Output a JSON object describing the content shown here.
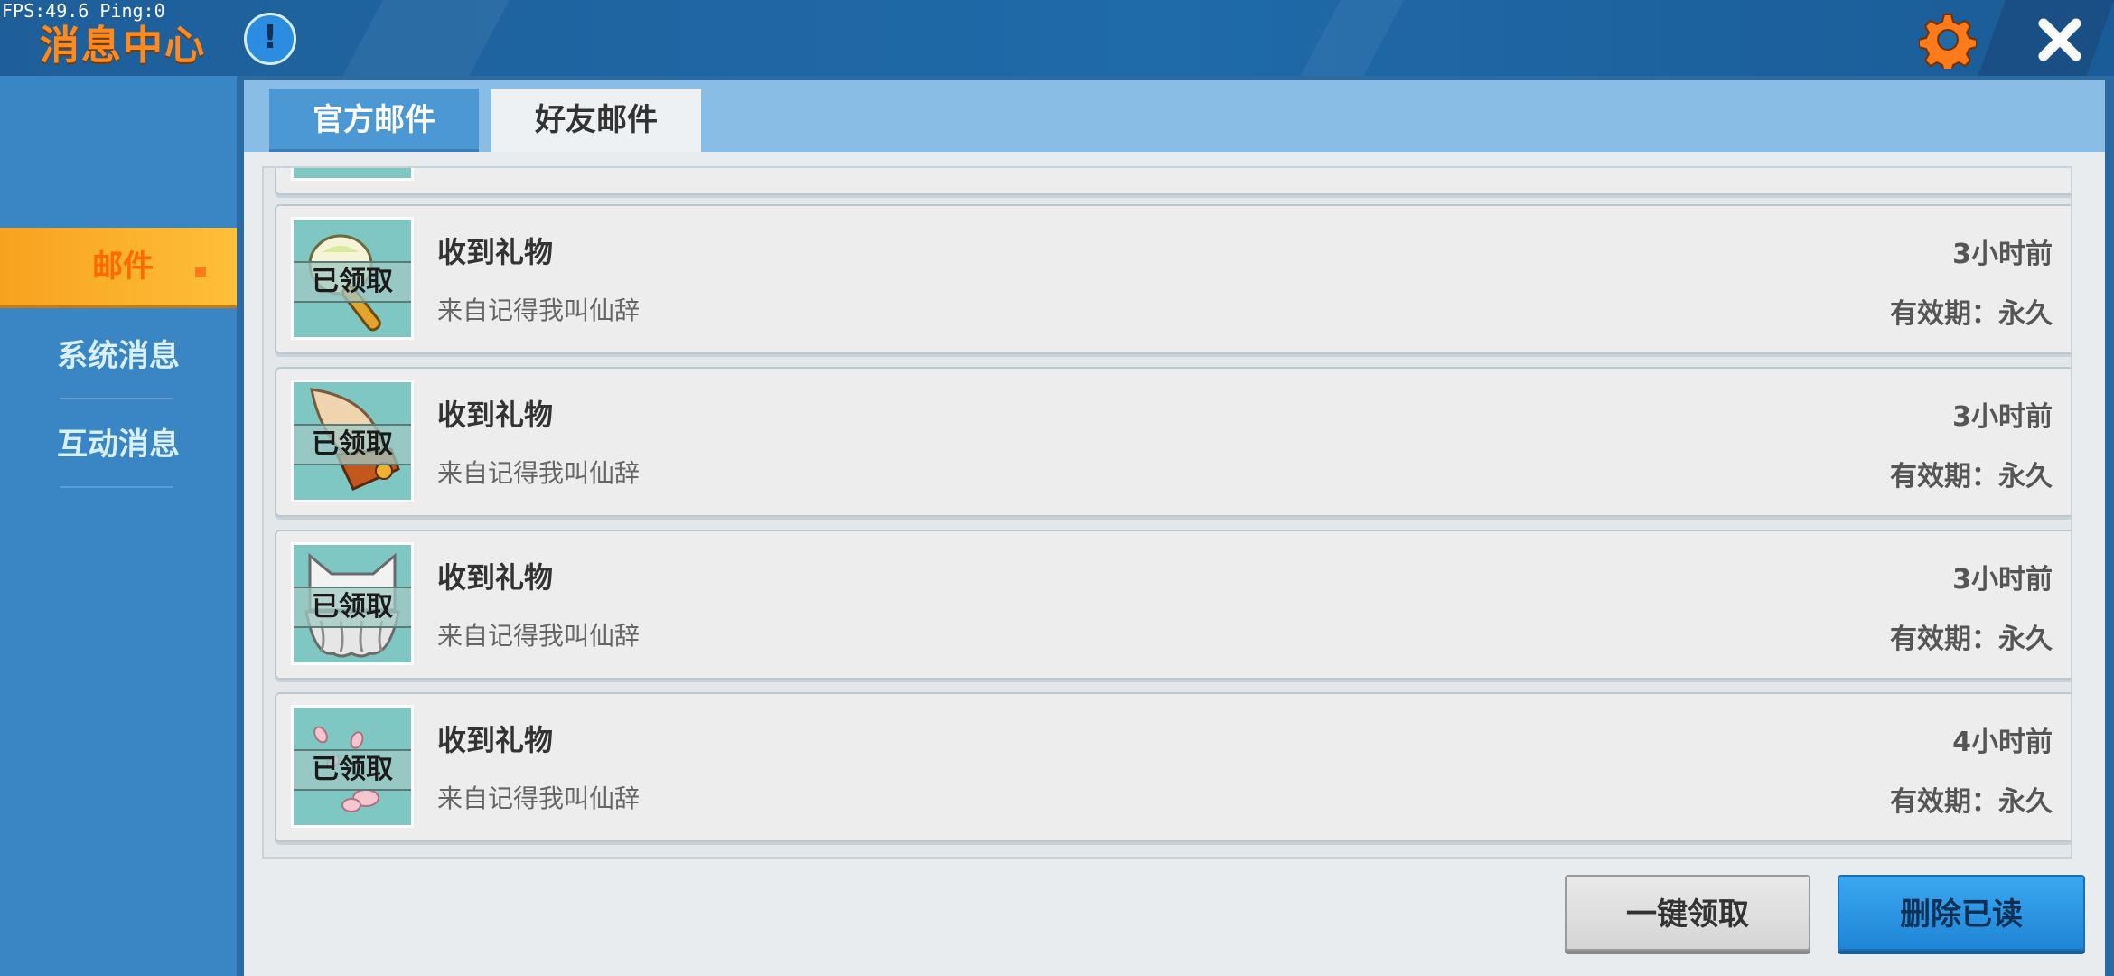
{
  "overlay": {
    "fps_text": "FPS:49.6  Ping:0"
  },
  "header": {
    "title": "消息中心"
  },
  "sidebar": {
    "items": [
      {
        "label": "邮件",
        "active": true
      },
      {
        "label": "系统消息",
        "active": false
      },
      {
        "label": "互动消息",
        "active": false
      }
    ]
  },
  "tabs": [
    {
      "label": "官方邮件",
      "active": false
    },
    {
      "label": "好友邮件",
      "active": true
    }
  ],
  "mails": [
    {
      "title": "收到礼物",
      "sender": "来自记得我叫仙辞",
      "time": "3小时前",
      "validity": "有效期：永久",
      "badge": "已领取",
      "icon": "bubble-wand-icon"
    },
    {
      "title": "收到礼物",
      "sender": "来自记得我叫仙辞",
      "time": "3小时前",
      "validity": "有效期：永久",
      "badge": "已领取",
      "icon": "horn-shell-icon"
    },
    {
      "title": "收到礼物",
      "sender": "来自记得我叫仙辞",
      "time": "3小时前",
      "validity": "有效期：永久",
      "badge": "已领取",
      "icon": "cat-ear-hat-icon"
    },
    {
      "title": "收到礼物",
      "sender": "来自记得我叫仙辞",
      "time": "4小时前",
      "validity": "有效期：永久",
      "badge": "已领取",
      "icon": "sakura-petals-icon"
    }
  ],
  "actions": {
    "claim_all": "一键领取",
    "delete_read": "删除已读"
  },
  "colors": {
    "accent_orange": "#ff8a1f",
    "header_blue": "#1e5f9a",
    "tab_active_bg": "#eef1f3",
    "thumb_bg": "#7ec7c2"
  }
}
